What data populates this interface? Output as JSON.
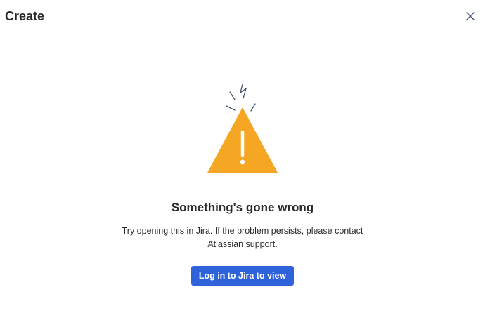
{
  "dialog": {
    "title": "Create",
    "close_icon": "close-icon"
  },
  "illustration": {
    "icon": "warning-triangle-icon",
    "color": "#f5a623"
  },
  "error": {
    "heading": "Something's gone wrong",
    "message_line1": "Try opening this in Jira. If the problem persists, please contact",
    "message_line2": "Atlassian support."
  },
  "actions": {
    "login_label": "Log in to Jira to view"
  },
  "colors": {
    "primary_button": "#2f63d9",
    "text": "#292a2e",
    "warning": "#f5a623"
  }
}
